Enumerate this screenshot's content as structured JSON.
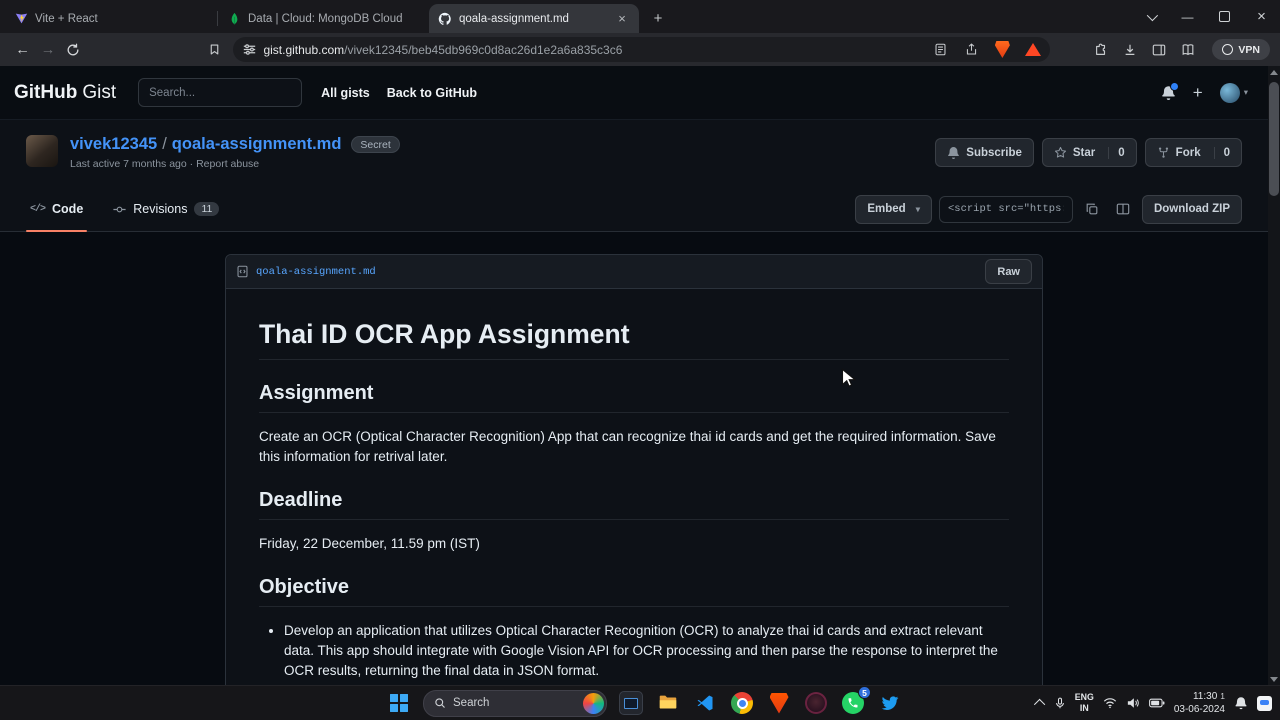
{
  "browser": {
    "tabs": [
      {
        "title": "Vite + React",
        "active": false
      },
      {
        "title": "Data | Cloud: MongoDB Cloud",
        "active": false
      },
      {
        "title": "qoala-assignment.md",
        "active": true
      }
    ],
    "address": {
      "host": "gist.github.com",
      "path": "/vivek12345/beb45db969c0d8ac26d1e2a6a835c3c6"
    },
    "vpn_label": "VPN"
  },
  "icons": {
    "code_glyph": "</>",
    "caret_down": "▾",
    "back_glyph": "←",
    "forward_glyph": "→",
    "plus_glyph": "+",
    "close_glyph": "×",
    "minimize_glyph": "—",
    "meta_dot": "·",
    "named": [
      "vite-icon",
      "mongodb-leaf-icon",
      "github-octocat-icon",
      "reload-icon",
      "bookmark-icon",
      "tune-icon",
      "reader-mode-icon",
      "share-icon",
      "brave-shield-icon",
      "brave-rewards-icon",
      "extensions-puzzle-icon",
      "download-icon",
      "sidebar-icon",
      "reading-list-icon",
      "bell-icon",
      "star-icon",
      "fork-icon",
      "copy-icon",
      "columns-icon",
      "commit-icon",
      "search-icon",
      "wifi-icon",
      "volume-icon",
      "battery-icon",
      "mic-icon"
    ]
  },
  "gist_header": {
    "logo_primary": "GitHub",
    "logo_secondary": "Gist",
    "search_placeholder": "Search...",
    "nav_all_gists": "All gists",
    "nav_back": "Back to GitHub"
  },
  "gist": {
    "owner": "vivek12345",
    "path_separator": "/",
    "filename": "qoala-assignment.md",
    "visibility_badge": "Secret",
    "last_active": "Last active 7 months ago",
    "report_abuse": "Report abuse",
    "subscribe_label": "Subscribe",
    "star_label": "Star",
    "star_count": "0",
    "fork_label": "Fork",
    "fork_count": "0"
  },
  "gist_tabs": {
    "code_label": "Code",
    "revisions_label": "Revisions",
    "revisions_count": "11",
    "embed_label": "Embed",
    "embed_snippet": "<script src=\"https://",
    "download_label": "Download ZIP"
  },
  "file": {
    "name": "qoala-assignment.md",
    "raw_label": "Raw"
  },
  "document": {
    "title": "Thai ID OCR App Assignment",
    "sections": [
      {
        "heading": "Assignment",
        "body": "Create an OCR (Optical Character Recognition) App that can recognize thai id cards and get the required information. Save this information for retrival later."
      },
      {
        "heading": "Deadline",
        "body": "Friday, 22 December, 11.59 pm (IST)"
      },
      {
        "heading": "Objective",
        "bullets": [
          "Develop an application that utilizes Optical Character Recognition (OCR) to analyze thai id cards and extract relevant data. This app should integrate with Google Vision API for OCR processing and then parse the response to interpret the OCR results, returning the final data in JSON format."
        ]
      }
    ]
  },
  "taskbar": {
    "search_placeholder": "Search",
    "whatsapp_badge": "5",
    "lang_line1": "ENG",
    "lang_line2": "IN",
    "time": "11:30",
    "notif_badge": "1",
    "date": "03-06-2024"
  }
}
